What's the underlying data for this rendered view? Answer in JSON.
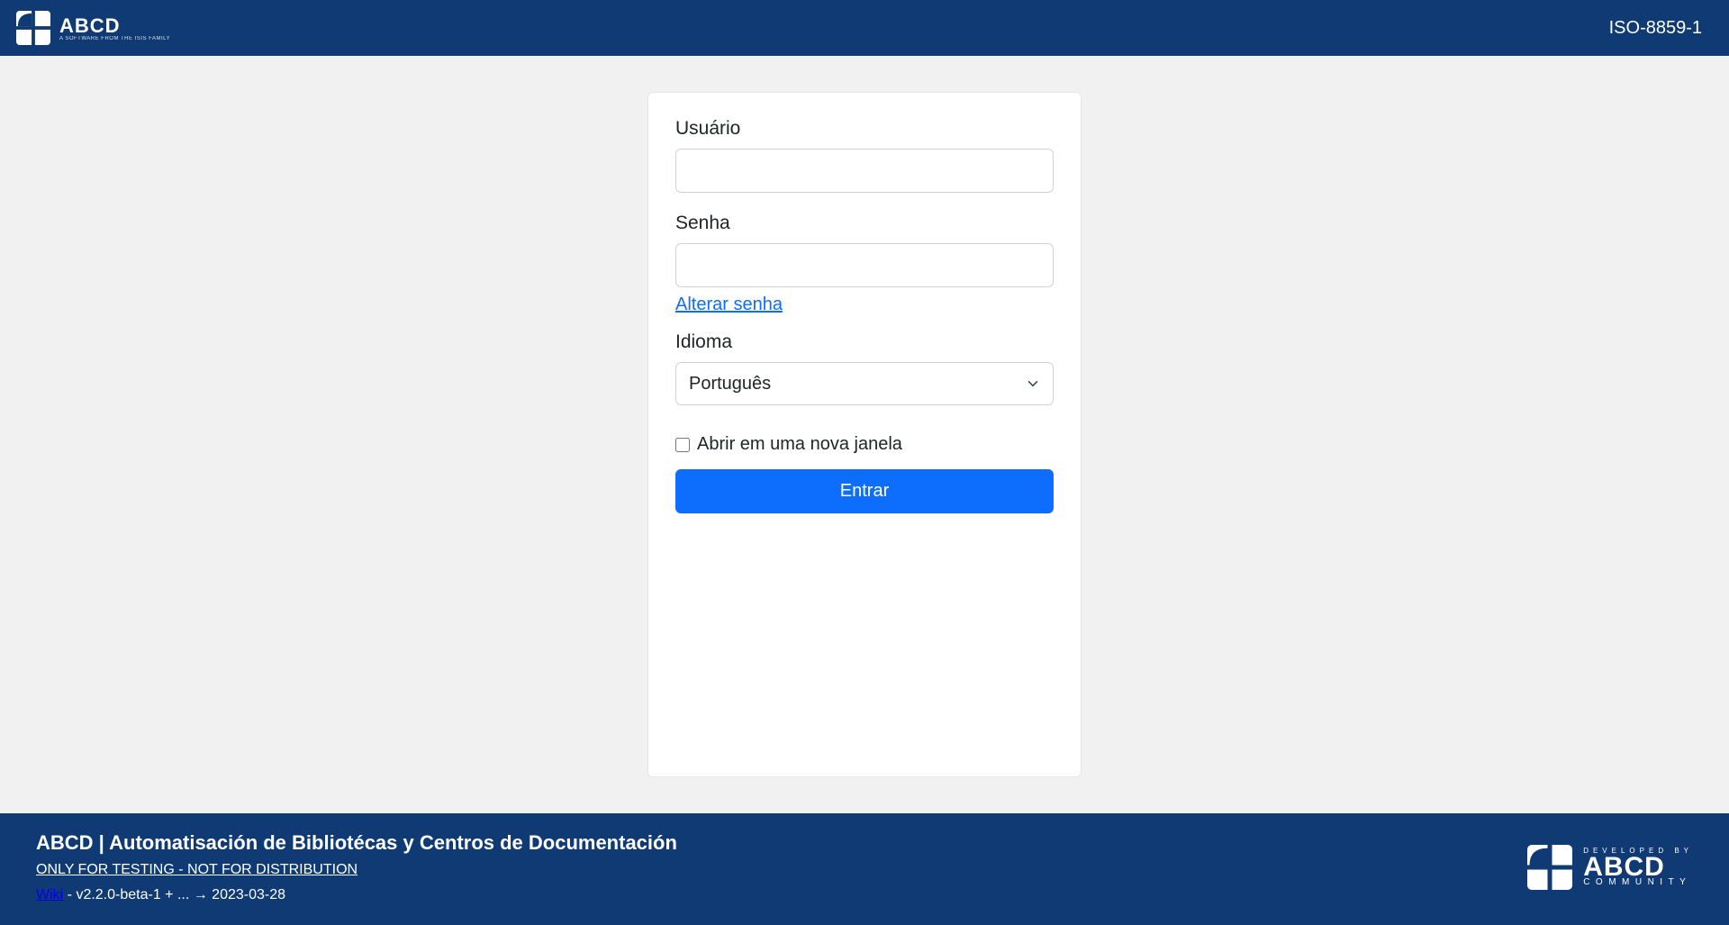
{
  "header": {
    "title": "ABCD",
    "subtitle": "A SOFTWARE FROM THE ISIS FAMILY",
    "encoding": "ISO-8859-1"
  },
  "login": {
    "username_label": "Usuário",
    "username_value": "",
    "password_label": "Senha",
    "password_value": "",
    "change_password": "Alterar senha",
    "language_label": "Idioma",
    "language_selected": "Português",
    "new_window_label": "Abrir em uma nova janela",
    "submit_label": "Entrar"
  },
  "footer": {
    "title": "ABCD | Automatisación de Bibliotécas y Centros de Documentación",
    "testing_notice": "ONLY FOR TESTING - NOT FOR DISTRIBUTION",
    "wiki_label": "Wiki",
    "version_text": " - v2.2.0-beta-1 + ... → 2023-03-28",
    "community_developed": "DEVELOPED BY",
    "community_abcd": "ABCD",
    "community_sub": "COMMUNITY"
  }
}
